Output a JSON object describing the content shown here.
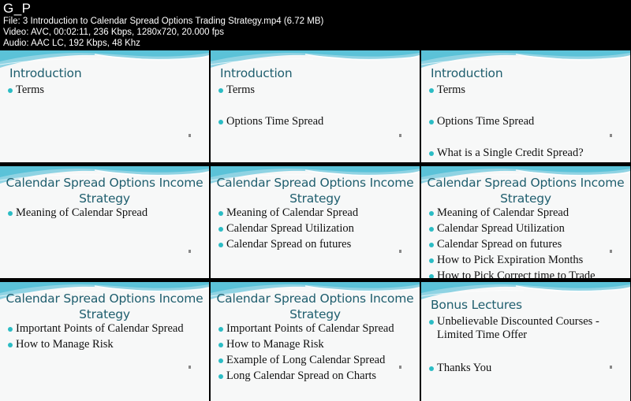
{
  "header": {
    "brand": "G_P",
    "file_line": "File: 3  Introduction to Calendar Spread Options Trading Strategy.mp4 (6.72 MB)",
    "video_line": "Video: AVC, 00:02:11, 236 Kbps, 1280x720, 20.000 fps",
    "audio_line": "Audio: AAC LC, 192 Kbps, 48 Khz"
  },
  "colors": {
    "title": "#1f5e6e",
    "bullet": "#2bbcc4",
    "wave": "#5bc2d8",
    "slide_bg": "#f7f8f8"
  },
  "slides": [
    {
      "title": "Introduction",
      "items": [
        "Terms"
      ]
    },
    {
      "title": "Introduction",
      "items": [
        "Terms",
        "Options Time Spread"
      ]
    },
    {
      "title": "Introduction",
      "items": [
        "Terms",
        "Options Time Spread",
        "What is a Single Credit Spread?"
      ]
    },
    {
      "title": "Calendar Spread Options Income Strategy",
      "items": [
        "Meaning of Calendar Spread"
      ]
    },
    {
      "title": "Calendar Spread Options Income Strategy",
      "items": [
        "Meaning of Calendar Spread",
        "Calendar Spread Utilization",
        "Calendar Spread on futures"
      ]
    },
    {
      "title": "Calendar Spread Options Income Strategy",
      "items": [
        "Meaning of Calendar Spread",
        "Calendar Spread Utilization",
        "Calendar Spread on futures",
        "How to Pick Expiration Months",
        "How to Pick Correct time to Trade"
      ]
    },
    {
      "title": "Calendar Spread Options Income Strategy",
      "items": [
        "Important Points of Calendar Spread",
        "How to Manage Risk"
      ]
    },
    {
      "title": "Calendar Spread Options Income Strategy",
      "items": [
        "Important Points of Calendar Spread",
        "How to Manage Risk",
        "Example of Long Calendar Spread",
        "Long Calendar Spread on Charts"
      ]
    },
    {
      "title": "Bonus Lectures",
      "items": [
        "Unbelievable Discounted Courses - Limited Time Offer",
        "Thanks You"
      ]
    }
  ]
}
